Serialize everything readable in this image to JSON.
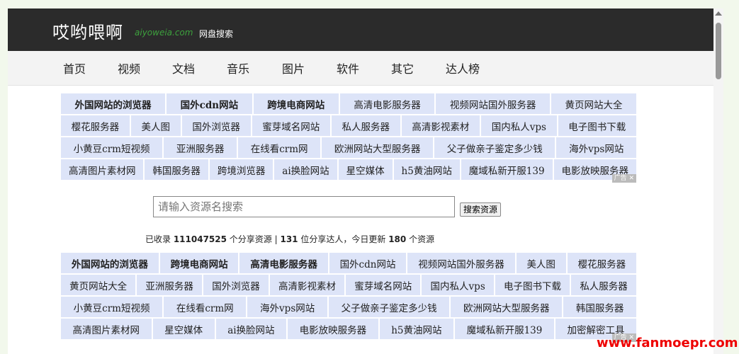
{
  "header": {
    "logo": "哎哟喂啊",
    "domain": "aiyoweia.com",
    "subtitle": "网盘搜索"
  },
  "nav": [
    "首页",
    "视频",
    "文档",
    "音乐",
    "图片",
    "软件",
    "其它",
    "达人榜"
  ],
  "top_tags": [
    [
      {
        "t": "外国网站的浏览器",
        "b": true
      },
      {
        "t": "国外cdn网站",
        "b": true
      },
      {
        "t": "跨境电商网站",
        "b": true
      },
      {
        "t": "高清电影服务器"
      },
      {
        "t": "视频网站国外服务器"
      },
      {
        "t": "黄页网站大全"
      }
    ],
    [
      {
        "t": "樱花服务器"
      },
      {
        "t": "美人图"
      },
      {
        "t": "国外浏览器"
      },
      {
        "t": "蜜芽域名网站"
      },
      {
        "t": "私人服务器"
      },
      {
        "t": "高清影视素材"
      },
      {
        "t": "国内私人vps"
      },
      {
        "t": "电子图书下载"
      }
    ],
    [
      {
        "t": "小黄豆crm短视频"
      },
      {
        "t": "亚洲服务器"
      },
      {
        "t": "在线看crm网"
      },
      {
        "t": "欧洲网站大型服务器"
      },
      {
        "t": "父子做亲子鉴定多少钱"
      },
      {
        "t": "海外vps网站"
      }
    ],
    [
      {
        "t": "高清图片素材网"
      },
      {
        "t": "韩国服务器"
      },
      {
        "t": "跨境浏览器"
      },
      {
        "t": "ai换脸网站"
      },
      {
        "t": "星空媒体"
      },
      {
        "t": "h5黄油网站"
      },
      {
        "t": "魔域私新开服139"
      },
      {
        "t": "电影放映服务器"
      }
    ]
  ],
  "search": {
    "placeholder": "请输入资源名搜索",
    "button": "搜索资源"
  },
  "stats": {
    "p1": "已收录 ",
    "shares": "111047525",
    "p2": " 个分享资源 | ",
    "users": "131",
    "p3": " 位分享达人，今日更新 ",
    "today": "180",
    "p4": " 个资源"
  },
  "bottom_tags": [
    [
      {
        "t": "外国网站的浏览器",
        "b": true
      },
      {
        "t": "跨境电商网站",
        "b": true
      },
      {
        "t": "高清电影服务器",
        "b": true
      },
      {
        "t": "国外cdn网站"
      },
      {
        "t": "视频网站国外服务器"
      },
      {
        "t": "美人图"
      },
      {
        "t": "樱花服务器"
      }
    ],
    [
      {
        "t": "黄页网站大全"
      },
      {
        "t": "亚洲服务器"
      },
      {
        "t": "国外浏览器"
      },
      {
        "t": "高清影视素材"
      },
      {
        "t": "蜜芽域名网站"
      },
      {
        "t": "国内私人vps"
      },
      {
        "t": "电子图书下载"
      },
      {
        "t": "私人服务器"
      }
    ],
    [
      {
        "t": "小黄豆crm短视频"
      },
      {
        "t": "在线看crm网"
      },
      {
        "t": "海外vps网站"
      },
      {
        "t": "父子做亲子鉴定多少钱"
      },
      {
        "t": "欧洲网站大型服务器"
      },
      {
        "t": "韩国服务器"
      }
    ],
    [
      {
        "t": "高清图片素材网"
      },
      {
        "t": "星空媒体"
      },
      {
        "t": "ai换脸网站"
      },
      {
        "t": "电影放映服务器"
      },
      {
        "t": "h5黄油网站"
      },
      {
        "t": "魔域私新开服139"
      },
      {
        "t": "加密解密工具"
      }
    ]
  ],
  "ad_mark": "广告 ✕",
  "watermark": "www.fanmoepr.com"
}
